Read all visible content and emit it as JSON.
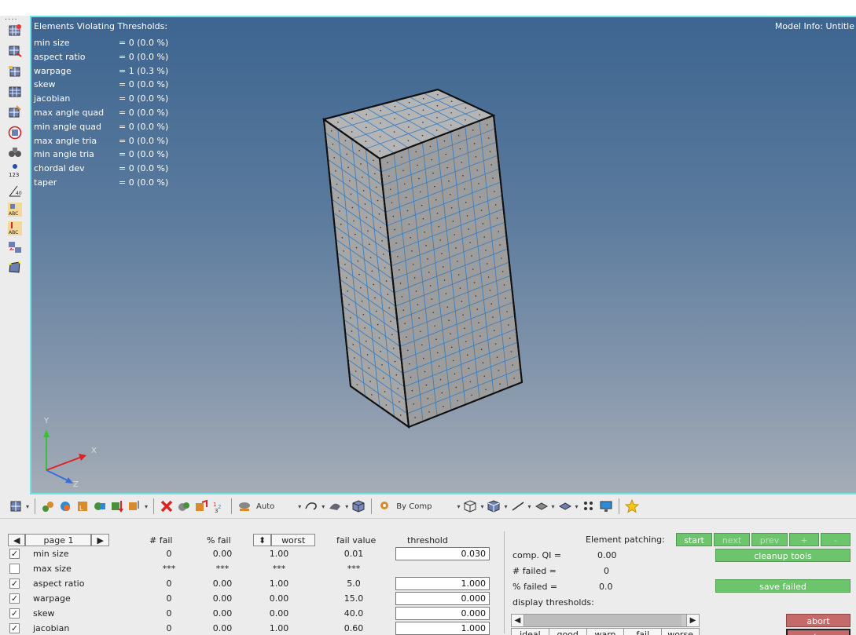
{
  "viewport": {
    "violations_title": "Elements Violating Thresholds:",
    "model_info": "Model Info: Untitle",
    "violations": [
      {
        "name": "min size",
        "value": "= 0 (0.0 %)"
      },
      {
        "name": "aspect ratio",
        "value": "= 0 (0.0 %)"
      },
      {
        "name": "warpage",
        "value": "= 1 (0.3 %)"
      },
      {
        "name": "skew",
        "value": "= 0 (0.0 %)"
      },
      {
        "name": "jacobian",
        "value": "= 0 (0.0 %)"
      },
      {
        "name": "max angle quad",
        "value": "= 0 (0.0 %)"
      },
      {
        "name": "min angle quad",
        "value": "= 0 (0.0 %)"
      },
      {
        "name": "max angle tria",
        "value": "= 0 (0.0 %)"
      },
      {
        "name": "min angle tria",
        "value": "= 0 (0.0 %)"
      },
      {
        "name": "chordal dev",
        "value": "= 0 (0.0 %)"
      },
      {
        "name": "taper",
        "value": "= 0 (0.0 %)"
      }
    ],
    "axis": {
      "x": "X",
      "y": "Y",
      "z": "Z"
    },
    "colors": {
      "bg_top": "#3d6590",
      "bg_bottom": "#a4acb6",
      "mesh_face": "#aaaaaa",
      "mesh_line": "#3a7fc1",
      "frame": "#6ee3e3"
    }
  },
  "toolbar": {
    "auto_label": "Auto",
    "bycomp_label": "By Comp"
  },
  "table": {
    "page_label": "page 1",
    "headers": {
      "fail": "# fail",
      "pct": "% fail",
      "worst": "worst",
      "fail_value": "fail value",
      "threshold": "threshold"
    },
    "rows": [
      {
        "checked": true,
        "name": "min size",
        "fail": "0",
        "pct": "0.00",
        "worst": "1.00",
        "fail_value": "0.01",
        "threshold": "0.030"
      },
      {
        "checked": false,
        "name": "max size",
        "fail": "***",
        "pct": "***",
        "worst": "***",
        "fail_value": "***",
        "threshold": ""
      },
      {
        "checked": true,
        "name": "aspect ratio",
        "fail": "0",
        "pct": "0.00",
        "worst": "1.00",
        "fail_value": "5.0",
        "threshold": "1.000"
      },
      {
        "checked": true,
        "name": "warpage",
        "fail": "0",
        "pct": "0.00",
        "worst": "0.00",
        "fail_value": "15.0",
        "threshold": "0.000"
      },
      {
        "checked": true,
        "name": "skew",
        "fail": "0",
        "pct": "0.00",
        "worst": "0.00",
        "fail_value": "40.0",
        "threshold": "0.000"
      },
      {
        "checked": true,
        "name": "jacobian",
        "fail": "0",
        "pct": "0.00",
        "worst": "1.00",
        "fail_value": "0.60",
        "threshold": "1.000"
      }
    ]
  },
  "right": {
    "patching_label": "Element patching:",
    "start": "start",
    "next": "next",
    "prev": "prev",
    "plus": "+",
    "minus": "-",
    "cleanup": "cleanup tools",
    "compqi_label": "comp. QI =",
    "compqi_value": "0.00",
    "failed_label": "# failed =",
    "failed_value": "0",
    "pctfailed_label": "% failed =",
    "pctfailed_value": "0.0",
    "save_failed": "save failed",
    "display_thresholds": "display thresholds:",
    "abort": "abort",
    "return": "return",
    "levels": [
      "ideal",
      "good",
      "warn",
      "fail",
      "worse"
    ]
  }
}
